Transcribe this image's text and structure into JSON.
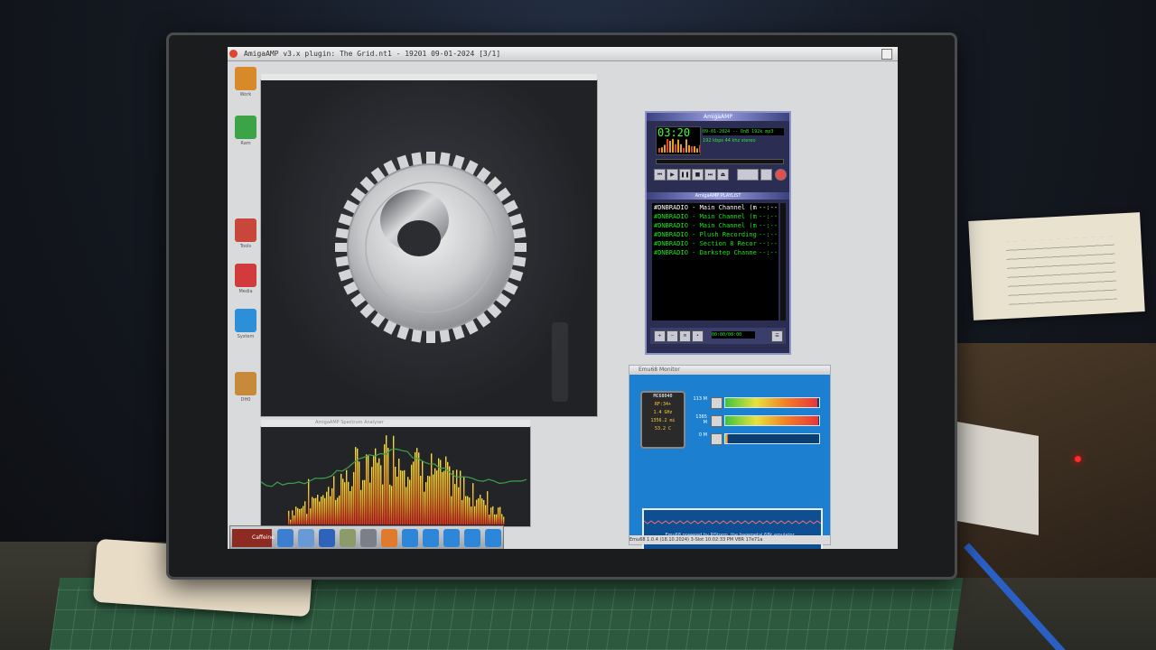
{
  "screen": {
    "window_title": "AmigaAMP v3.x plugin: The Grid.nt1 - 19201 09-01-2024 [3/1]"
  },
  "desktop_icons": [
    {
      "icon": "drive-icon",
      "label": "Work",
      "color": "#d88a2a"
    },
    {
      "icon": "globe-icon",
      "label": "Ram",
      "color": "#3aa447"
    },
    {
      "icon": "tools-icon",
      "label": "Tools",
      "color": "#c8473a"
    },
    {
      "icon": "media-icon",
      "label": "Media",
      "color": "#d13b3b"
    },
    {
      "icon": "folder-icon",
      "label": "System",
      "color": "#2e8fd9"
    },
    {
      "icon": "disk-icon",
      "label": "DH0",
      "color": "#c78a3a"
    }
  ],
  "gear_window": {
    "title": ""
  },
  "spectrum_window": {
    "title": "AmigaAMP Spectrum Analyser"
  },
  "amigaamp": {
    "title": "AmigaAMP",
    "time": "03:20",
    "marquee": "09-01-2024 -- DnB 192k mp3",
    "bitrate": "192 kbps  44 khz  stereo",
    "playlist_title": "AmigaAMP PLAYLIST",
    "playlist": [
      {
        "title": "#DNBRADIO - Main Channel (m",
        "duration": "--:--",
        "selected": true
      },
      {
        "title": "#DNBRADIO - Main Channel (m",
        "duration": "--:--",
        "selected": false
      },
      {
        "title": "#DNBRADIO - Main Channel (m",
        "duration": "--:--",
        "selected": false
      },
      {
        "title": "#DNBRADIO - Plush Recording",
        "duration": "--:--",
        "selected": false
      },
      {
        "title": "#DNBRADIO - Section 8 Recor",
        "duration": "--:--",
        "selected": false
      },
      {
        "title": "#DNBRADIO - Darkstep Channe",
        "duration": "--:--",
        "selected": false
      }
    ],
    "playlist_time": "00:00/00:00"
  },
  "emu68": {
    "title": "Emu68 Monitor",
    "chip": {
      "name": "MC68040",
      "line1": "RF:34+",
      "freq": "1.4 GHz",
      "mips": "1356.2 mi",
      "temp": "53.2 C"
    },
    "meters": [
      {
        "label": "113 M",
        "icon": "cpu-icon",
        "fill": 0.98
      },
      {
        "label": "1365 M",
        "icon": "mem-icon",
        "fill": 0.99
      },
      {
        "label": "0 M",
        "icon": "jit-icon",
        "fill": 0.03
      }
    ],
    "footer": "Emu68 powered by PiStorm, the baremetal 68k emulator",
    "status": "Emu68 1.0.4 (18.10.2024)  3-Slot  10:02:33 PM VBR  17e71a"
  },
  "dock": {
    "launch_label": "Caffeine"
  }
}
